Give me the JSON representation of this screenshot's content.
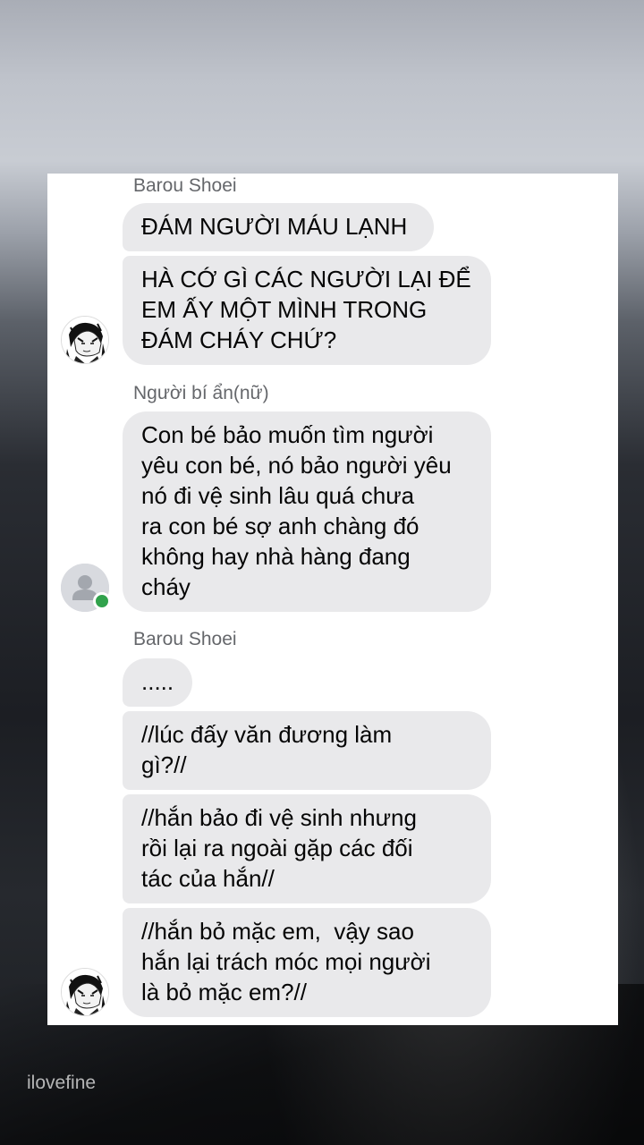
{
  "watermark": "ilovefine",
  "messages": [
    {
      "sender": "Barou Shoei",
      "avatar": "manga-portrait",
      "bubbles": [
        "ĐÁM NGƯỜI MÁU LẠNH",
        "HÀ CỚ GÌ CÁC NGƯỜI LẠI ĐỂ\nEM ẤY MỘT MÌNH TRONG\nĐÁM CHÁY CHỨ?"
      ]
    },
    {
      "sender": "Người bí ẩn(nữ)",
      "avatar": "default-person-icon",
      "online": true,
      "bubbles": [
        "Con bé bảo muốn tìm người\nyêu con bé, nó bảo người yêu\nnó đi vệ sinh lâu quá chưa\nra con bé sợ anh chàng đó\nkhông hay nhà hàng đang\ncháy"
      ]
    },
    {
      "sender": "Barou Shoei",
      "avatar": "manga-portrait",
      "bubbles": [
        ".....",
        "//lúc đấy văn đương làm\ngì?//",
        "//hắn bảo đi vệ sinh nhưng\nrồi lại ra ngoài gặp các đối\ntác của hắn//",
        "//hắn bỏ mặc em,  vậy sao\nhắn lại trách móc mọi người\nlà bỏ mặc em?//"
      ]
    }
  ],
  "colors": {
    "bubble": "#e9e9eb",
    "sender_name": "#65676b",
    "online": "#31a24c"
  }
}
